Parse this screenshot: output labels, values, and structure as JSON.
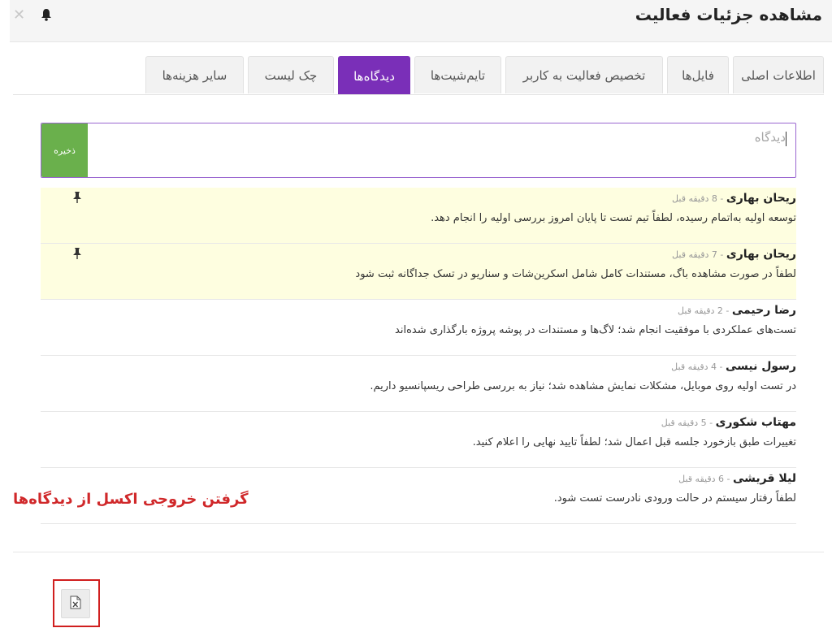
{
  "header": {
    "title": "مشاهده جزئیات فعالیت",
    "close_icon": "close-icon",
    "bell_icon": "bell-icon"
  },
  "tabs": [
    {
      "label": "اطلاعات اصلی",
      "active": false
    },
    {
      "label": "فایل‌ها",
      "active": false
    },
    {
      "label": "تخصیص فعالیت به کاربر",
      "active": false
    },
    {
      "label": "تایم‌شیت‌ها",
      "active": false
    },
    {
      "label": "دیدگاه‌ها",
      "active": true
    },
    {
      "label": "چک لیست",
      "active": false
    },
    {
      "label": "سایر هزینه‌ها",
      "active": false
    }
  ],
  "comment_form": {
    "placeholder": "دیدگاه",
    "value": "",
    "save_label": "ذخیره"
  },
  "comments": [
    {
      "author": "ریحان بهاری",
      "separator": " - ",
      "time": "8 دقیقه قبل",
      "text": "توسعه اولیه به‌اتمام رسیده، لطفاً تیم تست تا پایان امروز بررسی اولیه را انجام دهد.",
      "pinned": true
    },
    {
      "author": "ریحان بهاری",
      "separator": " - ",
      "time": "7 دقیقه قبل",
      "text": "لطفاً در صورت مشاهده باگ، مستندات کامل شامل اسکرین‌شات و سناریو در تسک جداگانه ثبت شود",
      "pinned": true
    },
    {
      "author": "رضا رحیمی",
      "separator": " - ",
      "time": "2 دقیقه قبل",
      "text": "تست‌های عملکردی با موفقیت انجام شد؛ لاگ‌ها و مستندات در پوشه پروژه بارگذاری شده‌اند",
      "pinned": false
    },
    {
      "author": "رسول نیسی",
      "separator": " - ",
      "time": "4 دقیقه قبل",
      "text": "در تست اولیه روی موبایل، مشکلات نمایش مشاهده شد؛ نیاز به بررسی طراحی ریسپانسیو داریم.",
      "pinned": false
    },
    {
      "author": "مهتاب شکوری",
      "separator": " - ",
      "time": "5 دقیقه قبل",
      "text": "تغییرات طبق بازخورد جلسه قبل اعمال شد؛ لطفاً تایید نهایی را اعلام کنید.",
      "pinned": false
    },
    {
      "author": "لیلا قریشی",
      "separator": " - ",
      "time": "6 دقیقه قبل",
      "text": "لطفاً رفتار سیستم در حالت ورودی نادرست تست شود.",
      "pinned": false
    }
  ],
  "annotation": "گرفتن خروجی اکسل از دیدگاه‌ها",
  "export": {
    "icon": "excel-file-icon"
  },
  "colors": {
    "accent": "#7a2fb8",
    "save": "#6ab04c",
    "pinned_bg": "#fefee0",
    "annotation": "#d0282a"
  }
}
